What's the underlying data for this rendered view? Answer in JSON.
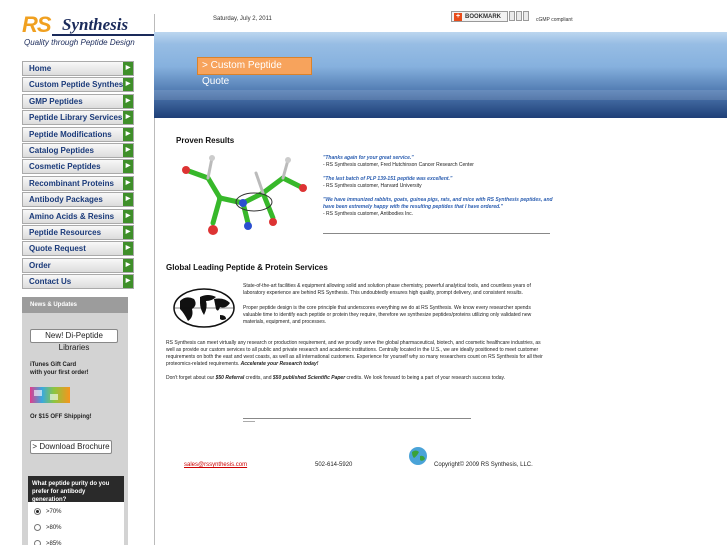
{
  "header": {
    "logo_rs": "RS",
    "logo_synthesis": "Synthesis",
    "logo_tagline": "Quality through Peptide Design",
    "date": "Saturday, July 2, 2011",
    "bookmark_label": "BOOKMARK",
    "cgmp": "cGMP compliant"
  },
  "banner": {
    "quote_button": "> Custom Peptide Quote"
  },
  "nav": {
    "items": [
      {
        "label": "Home"
      },
      {
        "label": "Custom Peptide Synthesis"
      },
      {
        "label": "GMP Peptides"
      },
      {
        "label": "Peptide Library Services"
      },
      {
        "label": "Peptide Modifications"
      },
      {
        "label": "Catalog Peptides"
      },
      {
        "label": "Cosmetic Peptides"
      },
      {
        "label": "Recombinant Proteins"
      },
      {
        "label": "Antibody Packages"
      },
      {
        "label": "Amino Acids & Resins"
      },
      {
        "label": "Peptide Resources"
      },
      {
        "label": "Quote Request"
      },
      {
        "label": "Order"
      },
      {
        "label": "Contact Us"
      }
    ]
  },
  "news": {
    "heading": "News & Updates",
    "libraries_button": "New!  Di-Peptide Libraries",
    "itunes_line1": "iTunes Gift Card",
    "itunes_line2": "with your first order!",
    "shipping": "Or $15 OFF Shipping!",
    "brochure_button": "> Download Brochure"
  },
  "poll": {
    "question": "What peptide purity do you prefer for antibody generation?",
    "options": [
      {
        "label": ">70%",
        "selected": true
      },
      {
        "label": ">80%",
        "selected": false
      },
      {
        "label": ">85%",
        "selected": false
      }
    ]
  },
  "proven": {
    "title": "Proven Results",
    "testimonials": [
      {
        "quote": "\"Thanks again for your great service.\"",
        "author": "- RS Synthesis customer, Fred Hutchinson Cancer Research Center"
      },
      {
        "quote": "\"The last batch of PLP 139-151 peptide was excellent.\"",
        "author": "- RS Synthesis customer, Harvard University"
      },
      {
        "quote": "\"We have immunized rabbits, goats, guinea pigs, rats, and mice with RS Synthesis peptides, and have been extremely happy with the resulting peptides that I have ordered.\"",
        "author": "- RS Synthesis customer, Antibodies Inc."
      }
    ]
  },
  "global": {
    "title": "Global Leading Peptide & Protein Services",
    "intro1": "State-of-the-art facilities & equipment allowing solid and solution phase chemistry, powerful analytical tools, and countless years of laboratory experience are behind RS Synthesis.  This undoubtedly ensures high quality, prompt delivery, and consistent results.",
    "intro2": "Proper peptide design is the core principle that underscores everything we do at RS Synthesis.  We know every researcher spends valuable time to identify each peptide or protein they require, therefore we synthesize peptides/proteins utilizing only validated new materials, equipment, and processes.",
    "body1": "RS Synthesis can meet virtually any research or production requirement, and we proudly serve the global pharmaceutical, biotech, and cosmetic healthcare industries, as well as provide our custom services to all public and private research and academic institutions.  Centrally located in the U.S., we are ideally positioned to meet customer requirements on both the east and west coasts, as well as all international customers.  Experience for yourself why so many researchers count on RS Synthesis for all their proteomics-related requirements.",
    "body1_highlight": " Accelerate your Research today!",
    "body2_pre": "Don't forget about our ",
    "body2_ref": "$50 Referral",
    "body2_mid": " credits, and ",
    "body2_paper": "$50 published Scientific Paper",
    "body2_post": " credits.  We look forward to being a part of your research success today."
  },
  "footer": {
    "email": "sales@rssynthesis.com",
    "phone": "502-614-5920",
    "copyright": "Copyright© 2009 RS Synthesis, LLC."
  }
}
